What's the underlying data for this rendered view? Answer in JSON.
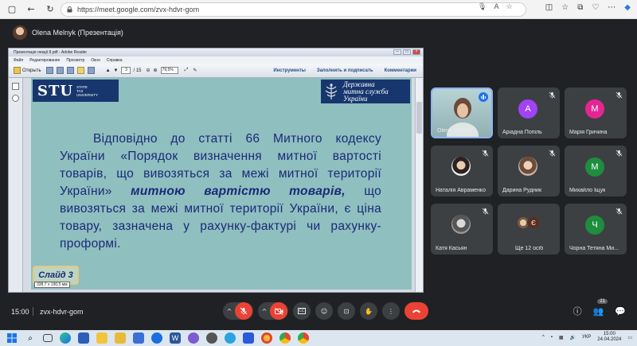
{
  "browser": {
    "url": "https://meet.google.com/zvx-hdvr-gom"
  },
  "meet": {
    "presenter_label": "Olena Melnyk (Презентація)",
    "time": "15:00",
    "meeting_code": "zvx-hdvr-gom",
    "people_count": "21"
  },
  "reader": {
    "title": "Презентація лекції 8.pdf - Adobe Reader",
    "menu": [
      "Файл",
      "Редактирование",
      "Просмотр",
      "Окно",
      "Справка"
    ],
    "open_label": "Открыть",
    "page_current": "3",
    "page_total": "/ 15",
    "zoom": "79,5%",
    "tools_right": [
      "Инструменты",
      "Заполнить и подписать",
      "Комментарии"
    ],
    "tooltip": "338,7 x 190,5 мм"
  },
  "slide": {
    "logo_left_mark": "STU",
    "logo_left_sub": [
      "STATE",
      "TAX",
      "UNIVERSITY"
    ],
    "logo_right": [
      "Державна",
      "митна служба",
      "України"
    ],
    "text_before": "Відповідно до статті 66 Митного кодексу України «Порядок визначення митної вартості товарів, що вивозяться за межі митної території України» ",
    "text_em": "митною вартістю товарів,",
    "text_after": " що вивозяться за межі митної території України, є ціна товару, зазначена у рахунку-фактурі чи рахунку-проформі.",
    "badge": "Слайд 3"
  },
  "participants": [
    {
      "name": "Olena Melnyk",
      "type": "webcam"
    },
    {
      "name": "Аріадна Попіль",
      "letter": "А",
      "color": "#a142f4"
    },
    {
      "name": "Марія Гричина",
      "letter": "М",
      "color": "#e52592"
    },
    {
      "name": "Наталія Авраменко",
      "type": "photo"
    },
    {
      "name": "Дарина Рудник",
      "type": "photo"
    },
    {
      "name": "Михайло Іщук",
      "letter": "М",
      "color": "#1e8e3e"
    },
    {
      "name": "Катя Касьян",
      "type": "photo"
    },
    {
      "name": "Ще 12 осіб",
      "type": "more",
      "more_letter": "Є"
    },
    {
      "name": "Чорна Тетяна Ми...",
      "letter": "Ч",
      "color": "#1e8e3e"
    }
  ],
  "taskbar": {
    "lang": "УКР",
    "clock_time": "15:00",
    "clock_date": "24.04.2024"
  },
  "colors": {
    "meet_bg": "#202124",
    "end_call": "#ea4335",
    "slide_bg": "#8fbfbf",
    "slide_text": "#1a2a78",
    "logo_navy": "#17366e"
  }
}
